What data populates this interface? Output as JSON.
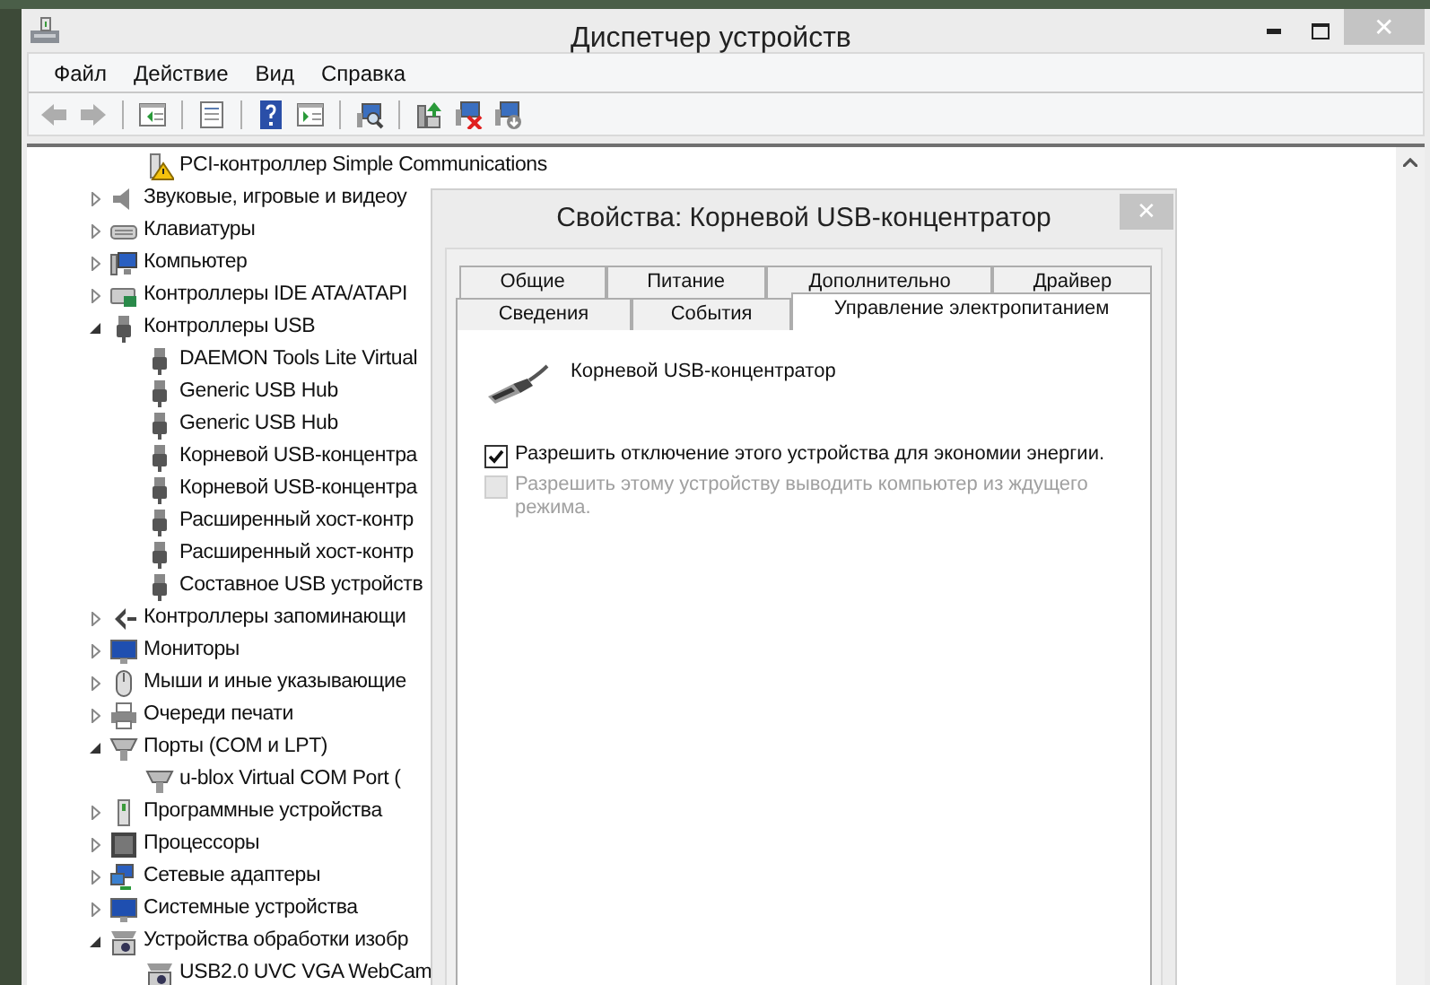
{
  "window": {
    "title": "Диспетчер устройств",
    "close": "✕"
  },
  "menu": [
    "Файл",
    "Действие",
    "Вид",
    "Справка"
  ],
  "toolbar": [
    {
      "kind": "back",
      "disabled": true
    },
    {
      "kind": "forward",
      "disabled": true
    },
    {
      "kind": "separator"
    },
    {
      "kind": "tree-pane",
      "disabled": false
    },
    {
      "kind": "separator"
    },
    {
      "kind": "properties",
      "disabled": false
    },
    {
      "kind": "separator"
    },
    {
      "kind": "help",
      "disabled": false
    },
    {
      "kind": "action-pane",
      "disabled": false
    },
    {
      "kind": "separator"
    },
    {
      "kind": "scan",
      "disabled": false
    },
    {
      "kind": "separator"
    },
    {
      "kind": "update",
      "disabled": false
    },
    {
      "kind": "uninstall",
      "disabled": false
    },
    {
      "kind": "disable",
      "disabled": false
    }
  ],
  "tree": {
    "continued_children": [
      {
        "label": "PCI-контроллер Simple Communications",
        "kind": "warning-device"
      }
    ],
    "items": [
      {
        "label": "Звуковые, игровые и видеоу",
        "kind": "speaker",
        "expanded": false
      },
      {
        "label": "Клавиатуры",
        "kind": "keyboard",
        "expanded": false
      },
      {
        "label": "Компьютер",
        "kind": "computer",
        "expanded": false
      },
      {
        "label": "Контроллеры IDE ATA/ATAPI",
        "kind": "ide",
        "expanded": false
      },
      {
        "label": "Контроллеры USB",
        "kind": "usb",
        "expanded": true,
        "children": [
          {
            "label": "DAEMON Tools Lite Virtual",
            "kind": "usb"
          },
          {
            "label": "Generic USB Hub",
            "kind": "usb"
          },
          {
            "label": "Generic USB Hub",
            "kind": "usb"
          },
          {
            "label": "Корневой USB-концентра",
            "kind": "usb"
          },
          {
            "label": "Корневой USB-концентра",
            "kind": "usb"
          },
          {
            "label": "Расширенный хост-контр",
            "kind": "usb"
          },
          {
            "label": "Расширенный хост-контр",
            "kind": "usb"
          },
          {
            "label": "Составное USB устройств",
            "kind": "usb"
          }
        ]
      },
      {
        "label": "Контроллеры запоминающи",
        "kind": "storage",
        "expanded": false
      },
      {
        "label": "Мониторы",
        "kind": "monitor",
        "expanded": false
      },
      {
        "label": "Мыши и иные указывающие",
        "kind": "mouse",
        "expanded": false
      },
      {
        "label": "Очереди печати",
        "kind": "printer",
        "expanded": false
      },
      {
        "label": "Порты (COM и LPT)",
        "kind": "port",
        "expanded": true,
        "children": [
          {
            "label": "u-blox Virtual COM Port (",
            "kind": "port"
          }
        ]
      },
      {
        "label": "Программные устройства",
        "kind": "software",
        "expanded": false
      },
      {
        "label": "Процессоры",
        "kind": "processor",
        "expanded": false
      },
      {
        "label": "Сетевые адаптеры",
        "kind": "network",
        "expanded": false
      },
      {
        "label": "Системные устройства",
        "kind": "monitor",
        "expanded": false
      },
      {
        "label": "Устройства обработки изобр",
        "kind": "camera",
        "expanded": true,
        "children": [
          {
            "label": "USB2.0 UVC VGA WebCam",
            "kind": "camera"
          }
        ]
      }
    ]
  },
  "dialog": {
    "title": "Свойства: Корневой USB-концентратор",
    "close": "✕",
    "tab_rows": [
      [
        {
          "label": "Общие",
          "selected": false
        },
        {
          "label": "Питание",
          "selected": false
        },
        {
          "label": "Дополнительно",
          "selected": false
        },
        {
          "label": "Драйвер",
          "selected": false
        }
      ],
      [
        {
          "label": "Сведения",
          "selected": false
        },
        {
          "label": "События",
          "selected": false
        },
        {
          "label": "Управление электропитанием",
          "selected": true
        }
      ]
    ],
    "device_name": "Корневой USB-концентратор",
    "options": [
      {
        "label": "Разрешить отключение этого устройства для экономии энергии.",
        "checked": true,
        "disabled": false
      },
      {
        "label": "Разрешить этому устройству выводить компьютер из ждущего режима.",
        "checked": false,
        "disabled": true
      }
    ]
  }
}
